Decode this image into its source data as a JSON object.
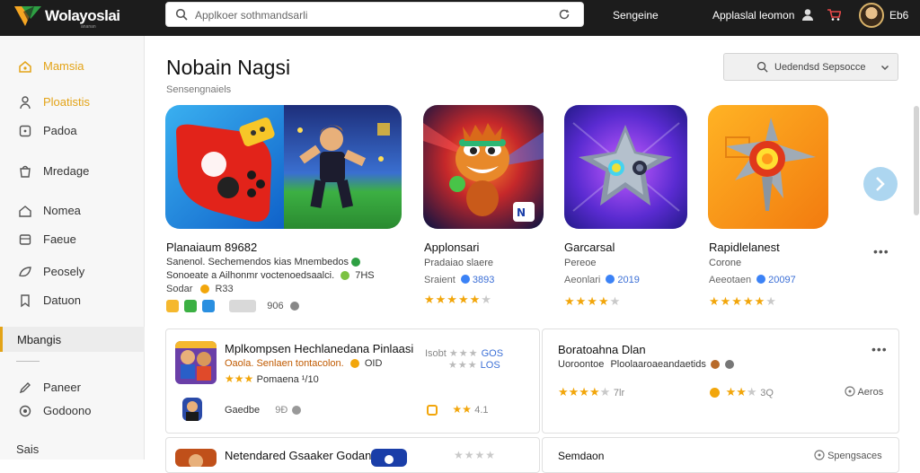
{
  "header": {
    "brand": "Wolayoslai",
    "brand_sub": "ananan",
    "search_placeholder": "Applkoer sothmandsarli",
    "link1": "Sengeine",
    "link2": "Applaslal leomon",
    "user": "Eb6"
  },
  "sidebar": {
    "items": [
      {
        "label": "Mamsia",
        "icon": "home-icon"
      },
      {
        "label": "Ploatistis",
        "icon": "person-icon"
      },
      {
        "label": "Padoa",
        "icon": "square-icon"
      },
      {
        "label": "Mredage",
        "icon": "bag-icon"
      },
      {
        "label": "Nomea",
        "icon": "house-icon"
      },
      {
        "label": "Faeue",
        "icon": "box-icon"
      },
      {
        "label": "Peosely",
        "icon": "leaf-icon"
      },
      {
        "label": "Datuon",
        "icon": "bookmark-icon"
      },
      {
        "label": "Mbangis"
      },
      {
        "label": "Paneer",
        "icon": "pencil-icon"
      },
      {
        "label": "Godoono",
        "icon": "target-icon"
      },
      {
        "label": "Sais"
      }
    ]
  },
  "main": {
    "title": "Nobain Nagsi",
    "subtitle": "Sensengnaiels",
    "sort_label": "Uedendsd Sepsocce"
  },
  "featured": [
    {
      "name": "Planaiaum 89682",
      "desc1": "Sanenol. Sechemendos kias Mnembedos",
      "desc2": "Sonoeate a Ailhonmr voctenoedsaalci.",
      "desc2_tail": "7HS",
      "meta": "Sodar",
      "meta_num": "R33",
      "badge_tail": "906"
    },
    {
      "name": "Applonsari",
      "dev": "Pradaiao slaere",
      "meta_label": "Sraient",
      "meta_num": "3893",
      "rating": 4.5
    },
    {
      "name": "Garcarsal",
      "dev": "Pereoe",
      "meta_label": "Aeonlari",
      "meta_num": "2019",
      "rating": 3.5
    },
    {
      "name": "Rapidlelanest",
      "dev": "Corone",
      "meta_label": "Aeeotaen",
      "meta_num": "20097",
      "rating": 4.5
    }
  ],
  "cards": [
    {
      "title": "Mplkompsen Hechlanedana Pinlaasi",
      "sub": "Oaola.  Senlaen tontacolon.",
      "sub_tail": "OID",
      "rating_label": "Pomaena ¹/10",
      "side_label": "Isobt",
      "side_num1": "GOS",
      "side_num2": "LOS",
      "bottom_label": "Gaedbe",
      "bottom_num": "9Ð",
      "bottom_right": "4.1"
    },
    {
      "title": "Boratoahna Dlan",
      "sub": "Uoroontoe",
      "sub_mid": "Ploolaaroaeandaetids",
      "rating_num": "7lr",
      "rating_num2": "3Q",
      "right_label": "Aeros"
    },
    {
      "title": "Netendared Gsaaker Godanol"
    },
    {
      "title": "Semdaon",
      "right_label": "Spengsaces"
    }
  ]
}
